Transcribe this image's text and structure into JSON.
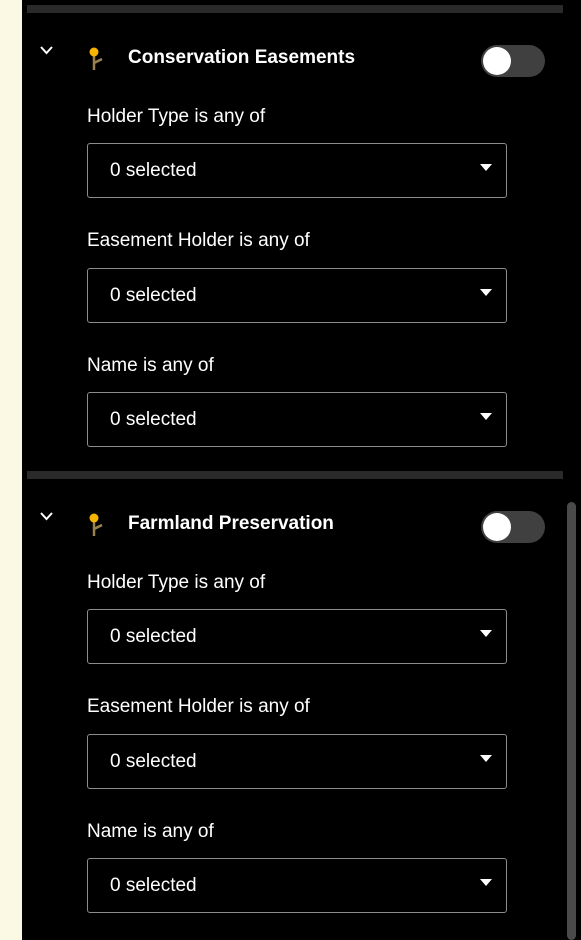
{
  "sections": [
    {
      "title": "Conservation Easements",
      "toggle_on": false,
      "filters": [
        {
          "label": "Holder Type is any of",
          "value": "0 selected"
        },
        {
          "label": "Easement Holder is any of",
          "value": "0 selected"
        },
        {
          "label": "Name is any of",
          "value": "0 selected"
        }
      ]
    },
    {
      "title": "Farmland Preservation",
      "toggle_on": false,
      "filters": [
        {
          "label": "Holder Type is any of",
          "value": "0 selected"
        },
        {
          "label": "Easement Holder is any of",
          "value": "0 selected"
        },
        {
          "label": "Name is any of",
          "value": "0 selected"
        }
      ]
    }
  ],
  "colors": {
    "page_background": "#fbf9e3",
    "panel_background": "#000000",
    "pin_head": "#f5b400",
    "pin_stem": "#9a8250",
    "toggle_off": "#404040"
  },
  "icons": {
    "chevron": "chevron-down-icon",
    "layer": "map-pin-icon"
  }
}
